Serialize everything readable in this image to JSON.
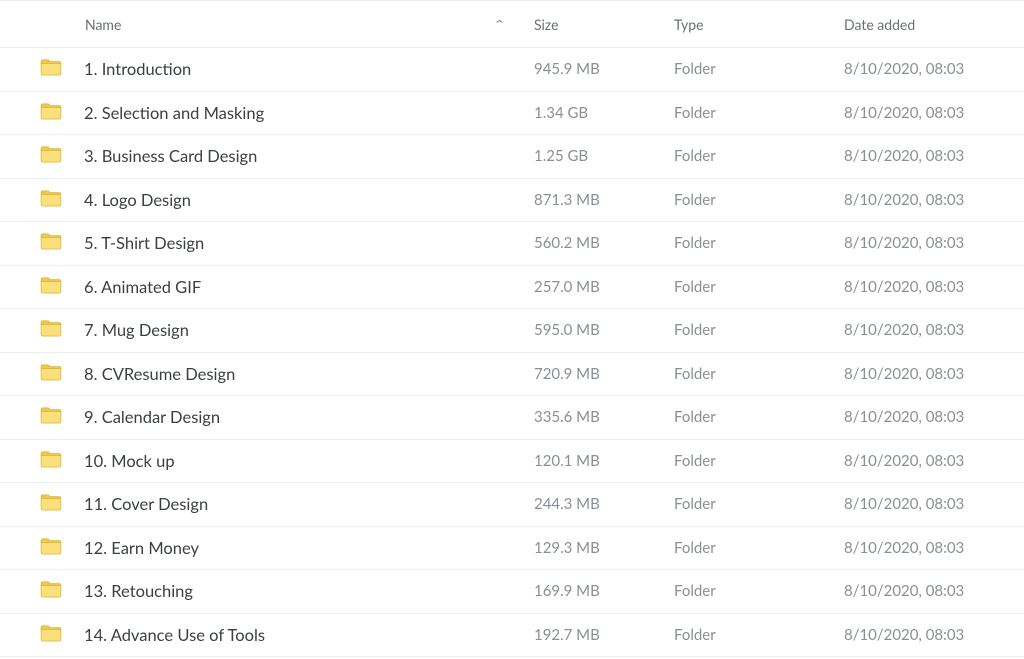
{
  "columns": {
    "name": "Name",
    "size": "Size",
    "type": "Type",
    "date_added": "Date added"
  },
  "sort": {
    "column": "name",
    "direction": "asc",
    "indicator": "⌃"
  },
  "rows": [
    {
      "name": "1. Introduction",
      "size": "945.9 MB",
      "type": "Folder",
      "date_added": "8/10/2020, 08:03"
    },
    {
      "name": "2. Selection and Masking",
      "size": "1.34 GB",
      "type": "Folder",
      "date_added": "8/10/2020, 08:03"
    },
    {
      "name": "3. Business Card Design",
      "size": "1.25 GB",
      "type": "Folder",
      "date_added": "8/10/2020, 08:03"
    },
    {
      "name": "4. Logo Design",
      "size": "871.3 MB",
      "type": "Folder",
      "date_added": "8/10/2020, 08:03"
    },
    {
      "name": "5. T-Shirt Design",
      "size": "560.2 MB",
      "type": "Folder",
      "date_added": "8/10/2020, 08:03"
    },
    {
      "name": "6. Animated GIF",
      "size": "257.0 MB",
      "type": "Folder",
      "date_added": "8/10/2020, 08:03"
    },
    {
      "name": "7. Mug Design",
      "size": "595.0 MB",
      "type": "Folder",
      "date_added": "8/10/2020, 08:03"
    },
    {
      "name": "8. CVResume Design",
      "size": "720.9 MB",
      "type": "Folder",
      "date_added": "8/10/2020, 08:03"
    },
    {
      "name": "9. Calendar Design",
      "size": "335.6 MB",
      "type": "Folder",
      "date_added": "8/10/2020, 08:03"
    },
    {
      "name": "10. Mock up",
      "size": "120.1 MB",
      "type": "Folder",
      "date_added": "8/10/2020, 08:03"
    },
    {
      "name": "11. Cover Design",
      "size": "244.3 MB",
      "type": "Folder",
      "date_added": "8/10/2020, 08:03"
    },
    {
      "name": "12. Earn Money",
      "size": "129.3 MB",
      "type": "Folder",
      "date_added": "8/10/2020, 08:03"
    },
    {
      "name": "13. Retouching",
      "size": "169.9 MB",
      "type": "Folder",
      "date_added": "8/10/2020, 08:03"
    },
    {
      "name": "14. Advance Use of Tools",
      "size": "192.7 MB",
      "type": "Folder",
      "date_added": "8/10/2020, 08:03"
    }
  ],
  "icons": {
    "folder": "folder-icon"
  }
}
